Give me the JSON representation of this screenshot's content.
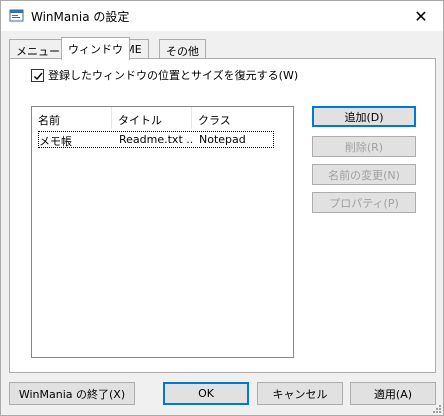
{
  "window": {
    "title": "WinMania の設定",
    "close_glyph": "✕"
  },
  "tabs": [
    {
      "label": "メニュー"
    },
    {
      "label": "ウィンドウ"
    },
    {
      "label": "IME"
    },
    {
      "label": "その他"
    }
  ],
  "restore_checkbox": {
    "label": "登録したウィンドウの位置とサイズを復元する(W)",
    "checked": true
  },
  "listview": {
    "columns": [
      "名前",
      "タイトル",
      "クラス"
    ],
    "rows": [
      {
        "name": "メモ帳",
        "title": "Readme.txt ...",
        "class": "Notepad"
      }
    ]
  },
  "side_buttons": {
    "add": "追加(D)",
    "delete": "削除(R)",
    "rename": "名前の変更(N)",
    "properties": "プロパティ(P)"
  },
  "bottom_buttons": {
    "quit": "WinMania の終了(X)",
    "ok": "OK",
    "cancel": "キャンセル",
    "apply": "適用(A)"
  },
  "colors": {
    "focus_border": "#0078d7",
    "disabled_text": "#a0a0a0"
  },
  "icons": {
    "app": "settings-window-icon",
    "close": "close-icon",
    "check": "checkmark-icon",
    "grip": "resize-grip-icon"
  }
}
